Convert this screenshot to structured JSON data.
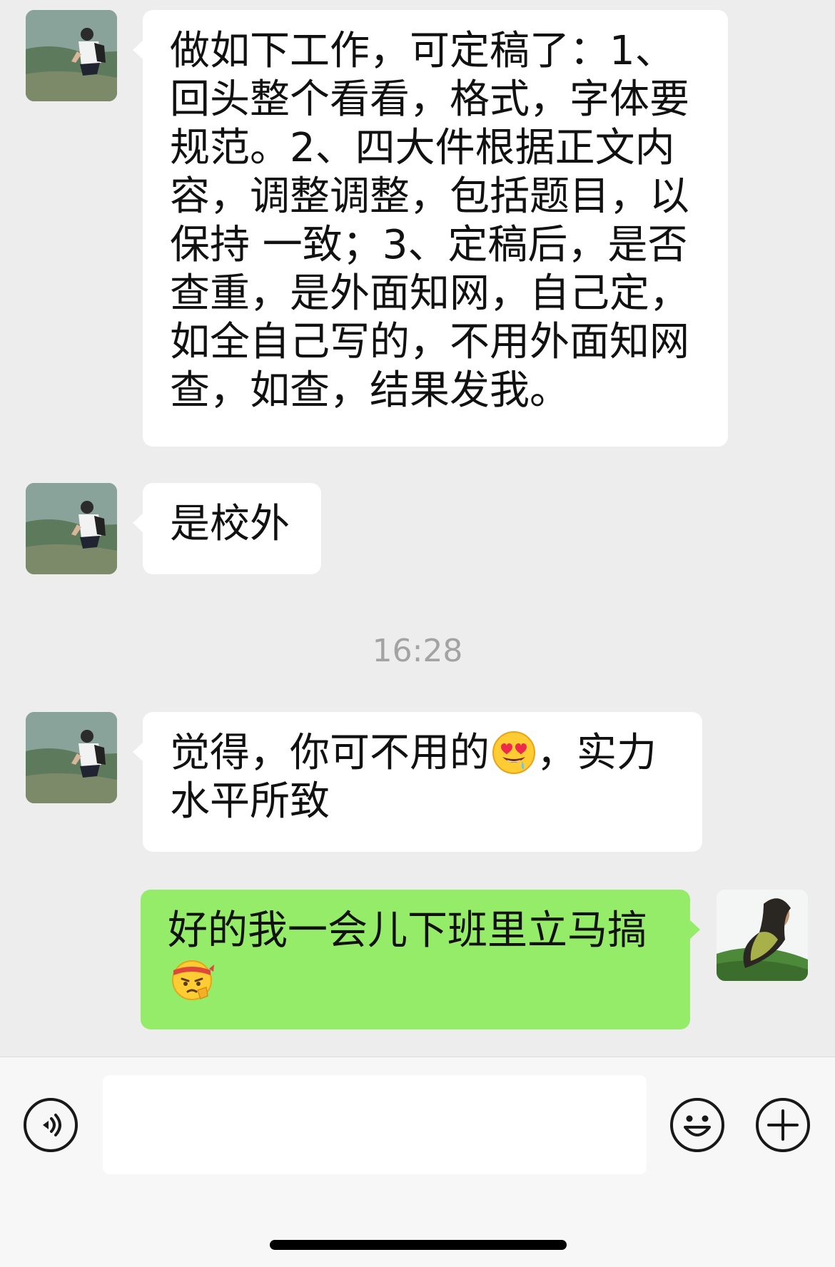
{
  "messages": [
    {
      "sender": "contact",
      "parts": {
        "text": "做如下工作，可定稿了：1、回头整个看看，格式，字体要规范。2、四大件根据正文内容，调整调整，包括题目，以保持 一致；3、定稿后，是否查重，是外面知网，自己定，如全自己写的，不用外面知网查，如查，结果发我。"
      }
    },
    {
      "sender": "contact",
      "parts": {
        "text": "是校外"
      }
    },
    {
      "sender": "contact",
      "parts": {
        "before_emoji": "觉得，你可不用的",
        "emoji": "heart-eyes-drooling-emoji",
        "after_emoji": "，实力水平所致"
      }
    },
    {
      "sender": "me",
      "parts": {
        "text": "好的我一会儿下班里立马搞",
        "emoji": "determined-headband-emoji"
      }
    }
  ],
  "timestamp": "16:28",
  "input_bar": {
    "text_value": "",
    "voice_icon": "voice-icon",
    "emoji_icon": "emoji-smile-icon",
    "add_icon": "plus-circle-icon"
  },
  "colors": {
    "background": "#ededed",
    "incoming_bubble": "#ffffff",
    "outgoing_bubble": "#95ec69",
    "timestamp": "#a3a3a3"
  }
}
